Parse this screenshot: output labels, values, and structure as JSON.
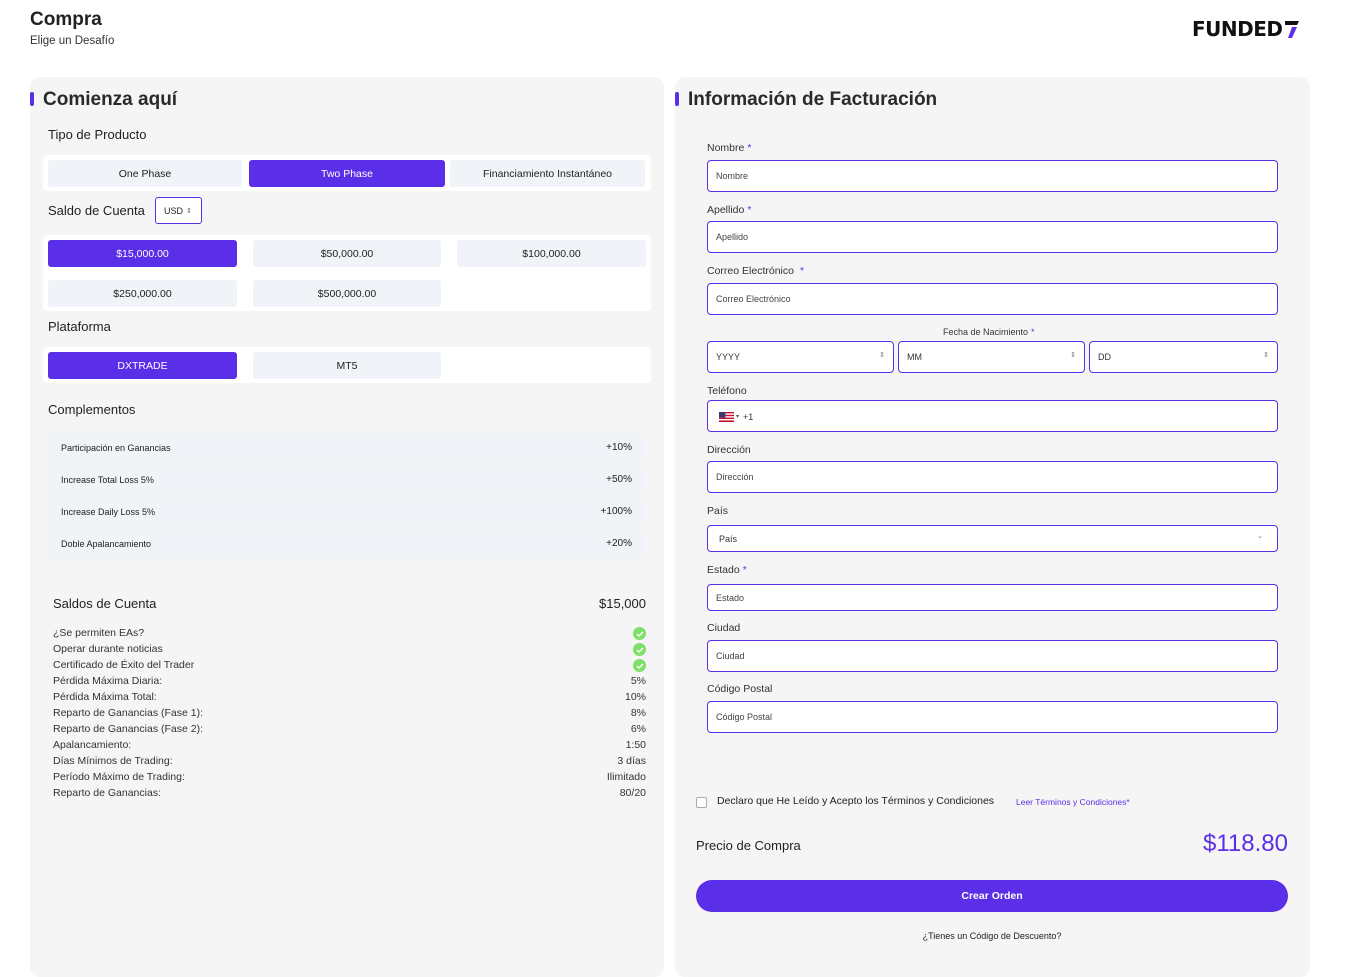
{
  "header": {
    "title": "Compra",
    "subtitle": "Elige un Desafío",
    "logo_text": "FUNDED"
  },
  "left": {
    "title": "Comienza aquí",
    "product_label": "Tipo de Producto",
    "products": [
      {
        "label": "One Phase",
        "selected": false
      },
      {
        "label": "Two Phase",
        "selected": true
      },
      {
        "label": "Financiamiento Instantáneo",
        "selected": false
      }
    ],
    "balance_label": "Saldo de Cuenta",
    "currency": "USD",
    "balances": [
      {
        "label": "$15,000.00",
        "selected": true
      },
      {
        "label": "$50,000.00",
        "selected": false
      },
      {
        "label": "$100,000.00",
        "selected": false
      },
      {
        "label": "$250,000.00",
        "selected": false
      },
      {
        "label": "$500,000.00",
        "selected": false
      }
    ],
    "platform_label": "Plataforma",
    "platforms": [
      {
        "label": "DXTRADE",
        "selected": true
      },
      {
        "label": "MT5",
        "selected": false
      }
    ],
    "addons_label": "Complementos",
    "addons": [
      {
        "name": "Participación en Ganancias",
        "price": "+10%"
      },
      {
        "name": "Increase Total Loss 5%",
        "price": "+50%"
      },
      {
        "name": "Increase Daily Loss 5%",
        "price": "+100%"
      },
      {
        "name": "Doble Apalancamiento",
        "price": "+20%"
      }
    ],
    "summary": {
      "heading": "Saldos de Cuenta",
      "amount": "$15,000",
      "checks": [
        "¿Se permiten EAs?",
        "Operar durante noticias",
        "Certificado de Éxito del Trader"
      ],
      "rows": [
        {
          "k": "Pérdida Máxima Diaria:",
          "v": "5%"
        },
        {
          "k": "Pérdida Máxima Total:",
          "v": "10%"
        },
        {
          "k": "Reparto de Ganancias (Fase 1):",
          "v": "8%"
        },
        {
          "k": "Reparto de Ganancias (Fase 2):",
          "v": "6%"
        },
        {
          "k": "Apalancamiento:",
          "v": "1:50"
        },
        {
          "k": "Días Mínimos de Trading:",
          "v": "3 días"
        },
        {
          "k": "Período Máximo de Trading:",
          "v": "Ilimitado"
        },
        {
          "k": "Reparto de Ganancias:",
          "v": "80/20"
        }
      ]
    }
  },
  "right": {
    "title": "Información de Facturación",
    "required_mark": "*",
    "fields": {
      "nombre": {
        "label": "Nombre",
        "placeholder": "Nombre"
      },
      "apellido": {
        "label": "Apellido",
        "placeholder": "Apellido"
      },
      "email": {
        "label": "Correo Electrónico",
        "placeholder": "Correo Electrónico"
      },
      "dob": {
        "label": "Fecha de Nacimiento",
        "yyyy": "YYYY",
        "mm": "MM",
        "dd": "DD"
      },
      "phone": {
        "label": "Teléfono",
        "code": "+1"
      },
      "direccion": {
        "label": "Dirección",
        "placeholder": "Dirección"
      },
      "pais": {
        "label": "País",
        "value": "País"
      },
      "estado": {
        "label": "Estado",
        "placeholder": "Estado"
      },
      "ciudad": {
        "label": "Ciudad",
        "placeholder": "Ciudad"
      },
      "cp": {
        "label": "Código Postal",
        "placeholder": "Código Postal"
      }
    },
    "terms_text": "Declaro que He Leído y Acepto los Términos y Condiciones",
    "terms_link": "Leer Términos y Condiciones*",
    "price_label": "Precio de Compra",
    "price": "$118.80",
    "order_button": "Crear Orden",
    "discount_text": "¿Tienes un Código de Descuento?"
  },
  "colors": {
    "accent": "#5b2ee8",
    "check": "#7ee06b",
    "panel": "#f5f5f5"
  }
}
